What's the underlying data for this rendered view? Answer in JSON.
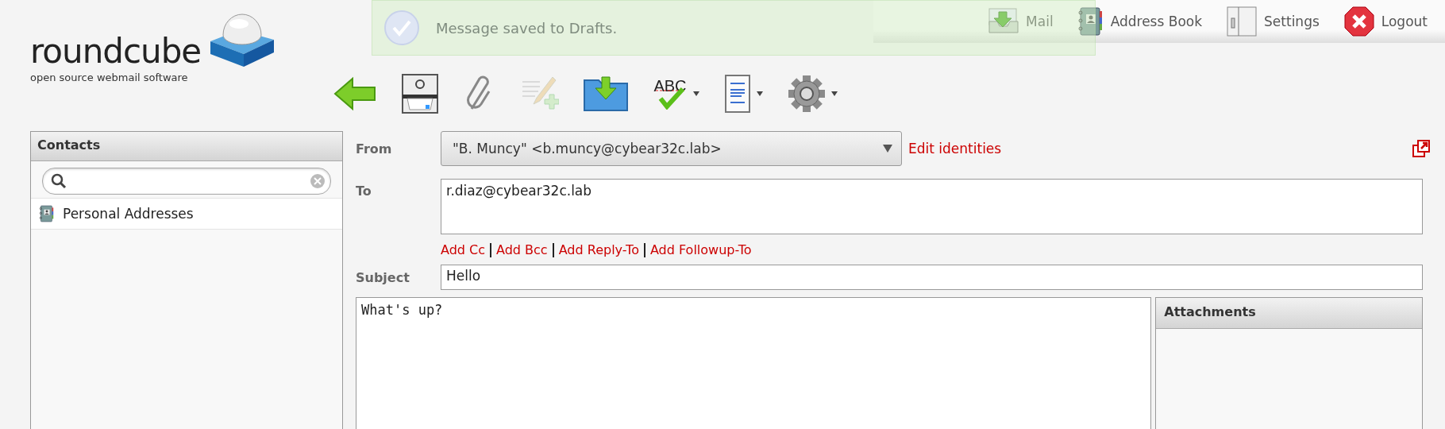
{
  "logo": {
    "name": "roundcube",
    "tagline": "open source webmail software"
  },
  "notification": {
    "message": "Message saved to Drafts."
  },
  "nav": [
    {
      "kind": "mail",
      "label": "Mail"
    },
    {
      "kind": "addressbook",
      "label": "Address Book"
    },
    {
      "kind": "settings",
      "label": "Settings"
    },
    {
      "kind": "logout",
      "label": "Logout"
    }
  ],
  "toolbar": [
    {
      "kind": "back",
      "dropdown": false,
      "disabled": false
    },
    {
      "kind": "save",
      "dropdown": false,
      "disabled": false
    },
    {
      "kind": "attach",
      "dropdown": false,
      "disabled": false
    },
    {
      "kind": "signature",
      "dropdown": false,
      "disabled": true
    },
    {
      "kind": "archive",
      "dropdown": false,
      "disabled": false
    },
    {
      "kind": "spell",
      "label": "ABC",
      "dropdown": true,
      "disabled": false
    },
    {
      "kind": "format",
      "dropdown": true,
      "disabled": false
    },
    {
      "kind": "options",
      "dropdown": true,
      "disabled": false
    }
  ],
  "contacts": {
    "title": "Contacts",
    "items": [
      {
        "label": "Personal Addresses"
      }
    ]
  },
  "compose": {
    "from_label": "From",
    "from_value": "\"B. Muncy\" <b.muncy@cybear32c.lab>",
    "edit_identities": "Edit identities",
    "to_label": "To",
    "to_value": "r.diaz@cybear32c.lab",
    "add_links": [
      "Add Cc",
      "Add Bcc",
      "Add Reply-To",
      "Add Followup-To"
    ],
    "subject_label": "Subject",
    "subject_value": "Hello",
    "body": "What's up?",
    "attachments_title": "Attachments"
  }
}
